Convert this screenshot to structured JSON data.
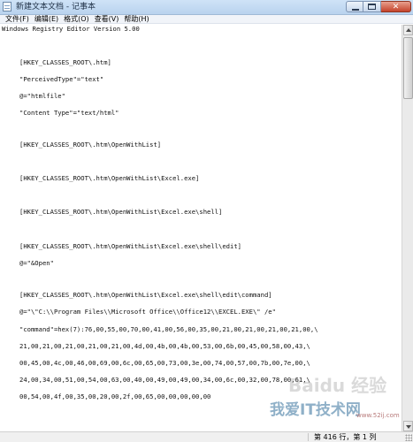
{
  "window": {
    "title": "新建文本文档 - 记事本",
    "close_label": "✕"
  },
  "menu": [
    "文件(F)",
    "编辑(E)",
    "格式(O)",
    "查看(V)",
    "帮助(H)"
  ],
  "lines": [
    "Windows Registry Editor Version 5.00",
    "[HKEY_CLASSES_ROOT\\.htm]",
    "\"PerceivedType\"=\"text\"",
    "@=\"htmlfile\"",
    "\"Content Type\"=\"text/html\"",
    "[HKEY_CLASSES_ROOT\\.htm\\OpenWithList]",
    "[HKEY_CLASSES_ROOT\\.htm\\OpenWithList\\Excel.exe]",
    "[HKEY_CLASSES_ROOT\\.htm\\OpenWithList\\Excel.exe\\shell]",
    "[HKEY_CLASSES_ROOT\\.htm\\OpenWithList\\Excel.exe\\shell\\edit]",
    "@=\"&Open\"",
    "[HKEY_CLASSES_ROOT\\.htm\\OpenWithList\\Excel.exe\\shell\\edit\\command]",
    "@=\"\\\"C:\\\\Program Files\\\\Microsoft Office\\\\Office12\\\\EXCEL.EXE\\\" /e\"",
    "\"command\"=hex(7):76,00,55,00,70,00,41,00,56,00,35,00,21,00,21,00,21,00,21,00,\\",
    "21,00,21,00,21,00,21,00,21,00,4d,00,4b,00,4b,00,53,00,6b,00,45,00,58,00,43,\\",
    "00,45,00,4c,00,46,00,69,00,6c,00,65,00,73,00,3e,00,74,00,57,00,7b,00,7e,00,\\",
    "24,00,34,00,51,00,54,00,63,00,40,00,49,00,49,00,34,00,6c,00,32,00,78,00,61,\\",
    "00,54,00,4f,00,35,00,20,00,2f,00,65,00,00,00,00,00"
  ],
  "status": {
    "position": "第 416 行，第 1 列"
  },
  "watermark": {
    "baidu": "Baidu 经验",
    "main": "我爱IT技术网",
    "url": "www.52ij.com"
  }
}
